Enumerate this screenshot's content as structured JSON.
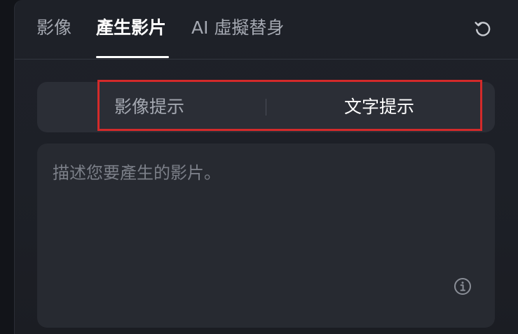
{
  "tabs": [
    {
      "label": "影像",
      "active": false
    },
    {
      "label": "產生影片",
      "active": true
    },
    {
      "label": "AI 虛擬替身",
      "active": false
    }
  ],
  "header": {
    "refresh_icon": "refresh-icon"
  },
  "prompt_mode": {
    "options": [
      {
        "label": "影像提示",
        "active": false
      },
      {
        "label": "文字提示",
        "active": true
      }
    ],
    "highlight_color": "#d42a2a"
  },
  "prompt": {
    "placeholder": "描述您要產生的影片。",
    "value": "",
    "info_icon": "info-icon"
  },
  "colors": {
    "background": "#121419",
    "panel": "#1e2128",
    "segmented_bg": "#2b2e36",
    "input_bg": "#272a31",
    "text_active": "#ffffff",
    "text_inactive": "#a4a8b1",
    "placeholder": "#7b7f88"
  }
}
